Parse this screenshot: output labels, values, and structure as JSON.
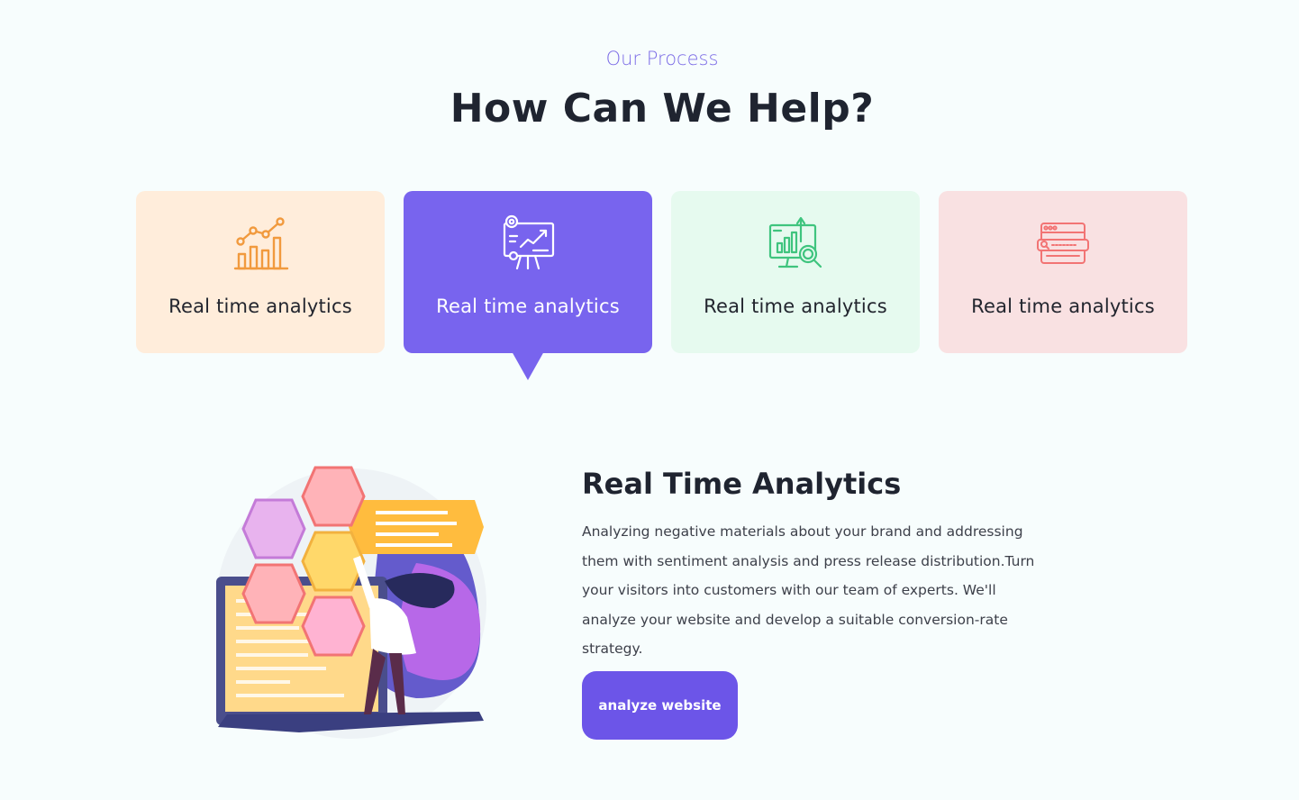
{
  "header": {
    "eyebrow": "Our Process",
    "title": "How Can We Help?"
  },
  "cards": [
    {
      "label": "Real time analytics",
      "icon": "line-bar-chart-icon",
      "bg": "#ffeddb",
      "accent": "#f19a3e"
    },
    {
      "label": "Real time analytics",
      "icon": "presentation-board-icon",
      "bg": "#7864ee",
      "accent": "#ffffff",
      "active": true
    },
    {
      "label": "Real time analytics",
      "icon": "monitor-chart-search-icon",
      "bg": "#e6faef",
      "accent": "#3fc47e"
    },
    {
      "label": "Real time analytics",
      "icon": "browser-search-icon",
      "bg": "#f9e1e2",
      "accent": "#f27474"
    }
  ],
  "detail": {
    "title": "Real Time Analytics",
    "body": "Analyzing negative materials about your brand and addressing them with sentiment analysis and press release distribution.Turn your visitors into customers with our team of experts. We'll analyze your website and develop a suitable conversion-rate strategy.",
    "button": "analyze website",
    "illustration": "woman-arranging-hexagons-illustration"
  },
  "colors": {
    "accent": "#7b6be6",
    "button": "#6c55e8",
    "background": "#f7fdfd"
  }
}
